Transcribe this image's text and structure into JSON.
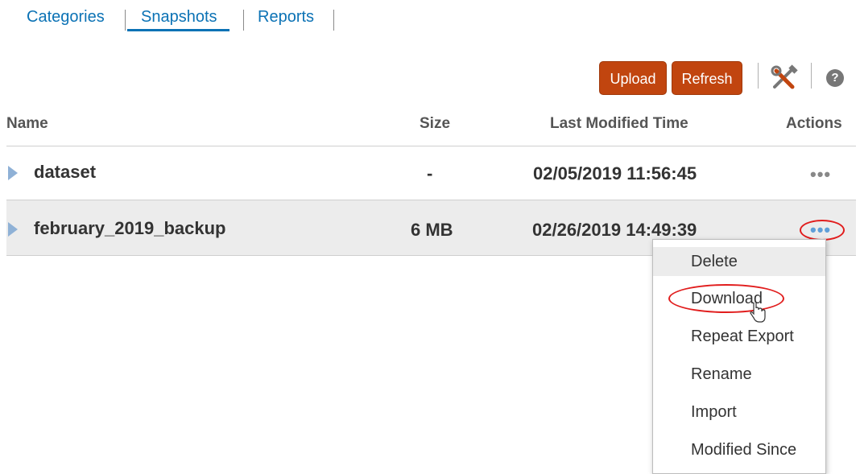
{
  "tabs": [
    {
      "label": "Categories",
      "active": false
    },
    {
      "label": "Snapshots",
      "active": true
    },
    {
      "label": "Reports",
      "active": false
    }
  ],
  "toolbar": {
    "upload_label": "Upload",
    "refresh_label": "Refresh",
    "tools_icon": "tools-icon",
    "help_icon": "help-icon",
    "help_glyph": "?"
  },
  "table": {
    "columns": [
      "Name",
      "Size",
      "Last Modified Time",
      "Actions"
    ],
    "rows": [
      {
        "name": "dataset",
        "size": "-",
        "modified": "02/05/2019 11:56:45",
        "actions": "•••"
      },
      {
        "name": "february_2019_backup",
        "size": "6 MB",
        "modified": "02/26/2019 14:49:39",
        "actions": "•••"
      }
    ]
  },
  "actions_menu": {
    "items": [
      "Delete",
      "Download",
      "Repeat Export",
      "Rename",
      "Import",
      "Modified Since"
    ]
  },
  "colors": {
    "accent": "#0b72b5",
    "button": "#c1450f",
    "highlight_ring": "#e11d1d"
  }
}
